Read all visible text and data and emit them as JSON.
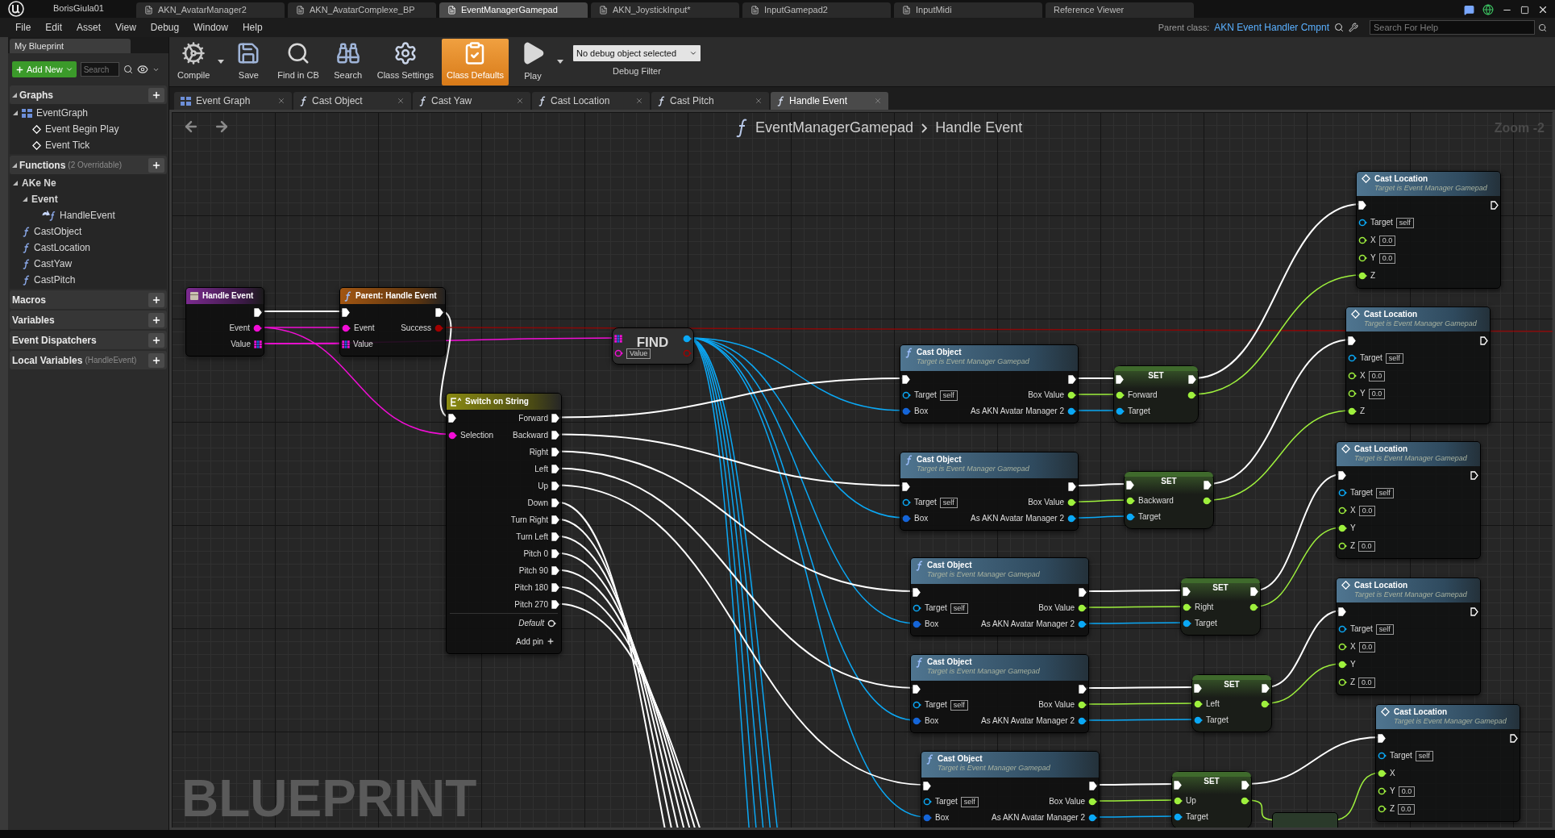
{
  "title_bar": {
    "project": "BorisGiula01",
    "tabs": [
      {
        "label": "AKN_AvatarManager2",
        "kind": "asset",
        "selected": false
      },
      {
        "label": "AKN_AvatarComplexe_BP",
        "kind": "asset",
        "selected": false
      },
      {
        "label": "EventManagerGamepad",
        "kind": "asset",
        "selected": true
      },
      {
        "label": "AKN_JoystickInput*",
        "kind": "asset",
        "selected": false
      },
      {
        "label": "InputGamepad2",
        "kind": "asset",
        "selected": false
      },
      {
        "label": "InputMidi",
        "kind": "asset",
        "selected": false
      },
      {
        "label": "Reference Viewer",
        "kind": "tool",
        "selected": false
      }
    ]
  },
  "menu": [
    "File",
    "Edit",
    "Asset",
    "View",
    "Debug",
    "Window",
    "Help"
  ],
  "parent_class": {
    "label": "Parent class:",
    "value": "AKN Event Handler Cmpnt"
  },
  "help_search": {
    "placeholder": "Search For Help"
  },
  "my_blueprint": {
    "tab": "My Blueprint",
    "add_new": "Add New",
    "search": {
      "placeholder": "Search"
    },
    "sections": [
      {
        "title": "Graphs",
        "expanded": true,
        "items": [
          {
            "label": "EventGraph",
            "kind": "graph",
            "expanded": true,
            "children": [
              {
                "label": "Event Begin Play",
                "kind": "event"
              },
              {
                "label": "Event Tick",
                "kind": "event"
              }
            ]
          }
        ]
      },
      {
        "title": "Functions",
        "note": "(2 Overridable)",
        "expanded": true,
        "items": [
          {
            "label": "AKe Ne",
            "kind": "category",
            "expanded": true,
            "children": [
              {
                "label": "Event",
                "kind": "category",
                "expanded": true,
                "children": [
                  {
                    "label": "HandleEvent",
                    "kind": "override"
                  }
                ]
              }
            ]
          },
          {
            "label": "CastObject",
            "kind": "function"
          },
          {
            "label": "CastLocation",
            "kind": "function"
          },
          {
            "label": "CastYaw",
            "kind": "function"
          },
          {
            "label": "CastPitch",
            "kind": "function"
          }
        ]
      },
      {
        "title": "Macros"
      },
      {
        "title": "Variables"
      },
      {
        "title": "Event Dispatchers"
      },
      {
        "title": "Local Variables",
        "note": "(HandleEvent)"
      }
    ]
  },
  "toolbar": {
    "buttons": [
      {
        "label": "Compile",
        "kind": "compile",
        "selected": false,
        "menu": true
      },
      {
        "label": "Save",
        "kind": "save",
        "selected": false,
        "menu": false
      },
      {
        "label": "Find in CB",
        "kind": "find",
        "selected": false,
        "menu": false
      },
      {
        "label": "Search",
        "kind": "search",
        "selected": false,
        "menu": false
      },
      {
        "label": "Class Settings",
        "kind": "settings",
        "selected": false,
        "menu": false
      },
      {
        "label": "Class Defaults",
        "kind": "defaults",
        "selected": true,
        "menu": false
      },
      {
        "label": "Play",
        "kind": "play",
        "selected": false,
        "menu": true
      }
    ],
    "debug": {
      "value": "No debug object selected",
      "label": "Debug Filter"
    }
  },
  "graph_tabs": [
    {
      "label": "Event Graph",
      "kind": "graph",
      "selected": false
    },
    {
      "label": "Cast Object",
      "kind": "function",
      "selected": false
    },
    {
      "label": "Cast Yaw",
      "kind": "function",
      "selected": false
    },
    {
      "label": "Cast Location",
      "kind": "function",
      "selected": false
    },
    {
      "label": "Cast Pitch",
      "kind": "function",
      "selected": false
    },
    {
      "label": "Handle Event",
      "kind": "function",
      "selected": true
    }
  ],
  "graph": {
    "breadcrumb": [
      "EventManagerGamepad",
      "Handle Event"
    ],
    "zoom": "Zoom -2",
    "watermark": "BLUEPRINT",
    "nodes": [
      {
        "kind": "event",
        "title": "Handle Event",
        "rows": [
          {
            "out": {
              "kind": "exec",
              "connected": true
            }
          },
          {
            "out": {
              "label": "Event",
              "kind": "string",
              "connected": true
            }
          },
          {
            "out": {
              "label": "Value",
              "kind": "array",
              "connected": true
            }
          }
        ]
      },
      {
        "kind": "parent",
        "title": "Parent: Handle Event",
        "rows": [
          {
            "in": {
              "kind": "exec",
              "connected": true
            },
            "out": {
              "kind": "exec",
              "connected": true
            }
          },
          {
            "in": {
              "label": "Event",
              "kind": "string",
              "connected": true
            },
            "out": {
              "label": "Success",
              "kind": "bool",
              "connected": true
            }
          },
          {
            "in": {
              "label": "Value",
              "kind": "array",
              "connected": true
            }
          }
        ]
      },
      {
        "kind": "find",
        "title": "FIND",
        "rows": [
          {
            "in": {
              "kind": "array",
              "connected": true
            },
            "out": {
              "kind": "object",
              "connected": true
            }
          },
          {
            "in": {
              "kind": "string",
              "connected": false,
              "default": "Value"
            },
            "out": {
              "kind": "bool",
              "connected": false
            }
          }
        ]
      },
      {
        "kind": "switch",
        "title": "Switch on String",
        "rows": [
          {
            "in": {
              "kind": "exec",
              "connected": true
            },
            "out": {
              "label": "Forward",
              "kind": "exec",
              "connected": true
            }
          },
          {
            "in": {
              "label": "Selection",
              "kind": "string",
              "connected": true
            },
            "out": {
              "label": "Backward",
              "kind": "exec",
              "connected": true
            }
          },
          {
            "out": {
              "label": "Right",
              "kind": "exec",
              "connected": true
            }
          },
          {
            "out": {
              "label": "Left",
              "kind": "exec",
              "connected": true
            }
          },
          {
            "out": {
              "label": "Up",
              "kind": "exec",
              "connected": true
            }
          },
          {
            "out": {
              "label": "Down",
              "kind": "exec",
              "connected": true
            }
          },
          {
            "out": {
              "label": "Turn Right",
              "kind": "exec",
              "connected": true
            }
          },
          {
            "out": {
              "label": "Turn Left",
              "kind": "exec",
              "connected": true
            }
          },
          {
            "out": {
              "label": "Pitch 0",
              "kind": "exec",
              "connected": true
            }
          },
          {
            "out": {
              "label": "Pitch 90",
              "kind": "exec",
              "connected": true
            }
          },
          {
            "out": {
              "label": "Pitch 180",
              "kind": "exec",
              "connected": true
            }
          },
          {
            "out": {
              "label": "Pitch 270",
              "kind": "exec",
              "connected": true
            }
          }
        ],
        "default_pin": {
          "label": "Default",
          "kind": "wildcard",
          "connected": false
        },
        "add_pin": "Add pin"
      },
      {
        "kind": "function",
        "title": "Cast Object",
        "subtitle": "Target is Event Manager Gamepad",
        "rows": [
          {
            "in": {
              "kind": "exec",
              "connected": true
            },
            "out": {
              "kind": "exec",
              "connected": true
            }
          },
          {
            "in": {
              "label": "Target",
              "kind": "object",
              "connected": false,
              "default": "self"
            },
            "out": {
              "label": "Box Value",
              "kind": "float",
              "connected": true
            }
          },
          {
            "in": {
              "label": "Box",
              "kind": "ref",
              "connected": true
            },
            "out": {
              "label": "As AKN Avatar Manager 2",
              "kind": "object",
              "connected": true
            }
          }
        ]
      },
      {
        "kind": "set",
        "title": "SET",
        "rows": [
          {
            "in": {
              "kind": "exec",
              "connected": true
            },
            "out": {
              "kind": "exec",
              "connected": true
            }
          },
          {
            "in": {
              "label": "Forward",
              "kind": "float",
              "connected": true
            },
            "out": {
              "kind": "float",
              "connected": true
            }
          },
          {
            "in": {
              "label": "Target",
              "kind": "object",
              "connected": true
            }
          }
        ]
      },
      {
        "kind": "function",
        "title": "Cast Object",
        "subtitle": "Target is Event Manager Gamepad",
        "rows": [
          {
            "in": {
              "kind": "exec",
              "connected": true
            },
            "out": {
              "kind": "exec",
              "connected": true
            }
          },
          {
            "in": {
              "label": "Target",
              "kind": "object",
              "connected": false,
              "default": "self"
            },
            "out": {
              "label": "Box Value",
              "kind": "float",
              "connected": true
            }
          },
          {
            "in": {
              "label": "Box",
              "kind": "ref",
              "connected": true
            },
            "out": {
              "label": "As AKN Avatar Manager 2",
              "kind": "object",
              "connected": true
            }
          }
        ]
      },
      {
        "kind": "set",
        "title": "SET",
        "rows": [
          {
            "in": {
              "kind": "exec",
              "connected": true
            },
            "out": {
              "kind": "exec",
              "connected": true
            }
          },
          {
            "in": {
              "label": "Backward",
              "kind": "float",
              "connected": true
            },
            "out": {
              "kind": "float",
              "connected": true
            }
          },
          {
            "in": {
              "label": "Target",
              "kind": "object",
              "connected": true
            }
          }
        ]
      },
      {
        "kind": "function",
        "title": "Cast Object",
        "subtitle": "Target is Event Manager Gamepad",
        "rows": [
          {
            "in": {
              "kind": "exec",
              "connected": true
            },
            "out": {
              "kind": "exec",
              "connected": true
            }
          },
          {
            "in": {
              "label": "Target",
              "kind": "object",
              "connected": false,
              "default": "self"
            },
            "out": {
              "label": "Box Value",
              "kind": "float",
              "connected": true
            }
          },
          {
            "in": {
              "label": "Box",
              "kind": "ref",
              "connected": true
            },
            "out": {
              "label": "As AKN Avatar Manager 2",
              "kind": "object",
              "connected": true
            }
          }
        ]
      },
      {
        "kind": "set",
        "title": "SET",
        "rows": [
          {
            "in": {
              "kind": "exec",
              "connected": true
            },
            "out": {
              "kind": "exec",
              "connected": true
            }
          },
          {
            "in": {
              "label": "Right",
              "kind": "float",
              "connected": true
            },
            "out": {
              "kind": "float",
              "connected": true
            }
          },
          {
            "in": {
              "label": "Target",
              "kind": "object",
              "connected": true
            }
          }
        ]
      },
      {
        "kind": "function",
        "title": "Cast Object",
        "subtitle": "Target is Event Manager Gamepad",
        "rows": [
          {
            "in": {
              "kind": "exec",
              "connected": true
            },
            "out": {
              "kind": "exec",
              "connected": true
            }
          },
          {
            "in": {
              "label": "Target",
              "kind": "object",
              "connected": false,
              "default": "self"
            },
            "out": {
              "label": "Box Value",
              "kind": "float",
              "connected": true
            }
          },
          {
            "in": {
              "label": "Box",
              "kind": "ref",
              "connected": true
            },
            "out": {
              "label": "As AKN Avatar Manager 2",
              "kind": "object",
              "connected": true
            }
          }
        ]
      },
      {
        "kind": "set",
        "title": "SET",
        "rows": [
          {
            "in": {
              "kind": "exec",
              "connected": true
            },
            "out": {
              "kind": "exec",
              "connected": true
            }
          },
          {
            "in": {
              "label": "Left",
              "kind": "float",
              "connected": true
            },
            "out": {
              "kind": "float",
              "connected": true
            }
          },
          {
            "in": {
              "label": "Target",
              "kind": "object",
              "connected": true
            }
          }
        ]
      },
      {
        "kind": "function",
        "title": "Cast Object",
        "subtitle": "Target is Event Manager Gamepad",
        "rows": [
          {
            "in": {
              "kind": "exec",
              "connected": true
            },
            "out": {
              "kind": "exec",
              "connected": true
            }
          },
          {
            "in": {
              "label": "Target",
              "kind": "object",
              "connected": false,
              "default": "self"
            },
            "out": {
              "label": "Box Value",
              "kind": "float",
              "connected": true
            }
          },
          {
            "in": {
              "label": "Box",
              "kind": "ref",
              "connected": true
            },
            "out": {
              "label": "As AKN Avatar Manager 2",
              "kind": "object",
              "connected": true
            }
          }
        ]
      },
      {
        "kind": "set",
        "title": "SET",
        "rows": [
          {
            "in": {
              "kind": "exec",
              "connected": true
            },
            "out": {
              "kind": "exec",
              "connected": true
            }
          },
          {
            "in": {
              "label": "Up",
              "kind": "float",
              "connected": true
            },
            "out": {
              "kind": "float",
              "connected": true
            }
          },
          {
            "in": {
              "label": "Target",
              "kind": "object",
              "connected": true
            }
          }
        ]
      },
      {
        "kind": "custom",
        "title": "Cast Location",
        "subtitle": "Target is Event Manager Gamepad",
        "rows": [
          {
            "in": {
              "kind": "exec",
              "connected": true
            },
            "out": {
              "kind": "exec",
              "connected": false
            }
          },
          {
            "in": {
              "label": "Target",
              "kind": "object",
              "connected": false,
              "default": "self"
            }
          },
          {
            "in": {
              "label": "X",
              "kind": "float",
              "connected": false,
              "default": "0.0"
            }
          },
          {
            "in": {
              "label": "Y",
              "kind": "float",
              "connected": false,
              "default": "0.0"
            }
          },
          {
            "in": {
              "label": "Z",
              "kind": "float",
              "connected": true
            }
          }
        ]
      },
      {
        "kind": "custom",
        "title": "Cast Location",
        "subtitle": "Target is Event Manager Gamepad",
        "rows": [
          {
            "in": {
              "kind": "exec",
              "connected": true
            },
            "out": {
              "kind": "exec",
              "connected": false
            }
          },
          {
            "in": {
              "label": "Target",
              "kind": "object",
              "connected": false,
              "default": "self"
            }
          },
          {
            "in": {
              "label": "X",
              "kind": "float",
              "connected": false,
              "default": "0.0"
            }
          },
          {
            "in": {
              "label": "Y",
              "kind": "float",
              "connected": false,
              "default": "0.0"
            }
          },
          {
            "in": {
              "label": "Z",
              "kind": "float",
              "connected": true
            }
          }
        ]
      },
      {
        "kind": "custom",
        "title": "Cast Location",
        "subtitle": "Target is Event Manager Gamepad",
        "rows": [
          {
            "in": {
              "kind": "exec",
              "connected": true
            },
            "out": {
              "kind": "exec",
              "connected": false
            }
          },
          {
            "in": {
              "label": "Target",
              "kind": "object",
              "connected": false,
              "default": "self"
            }
          },
          {
            "in": {
              "label": "X",
              "kind": "float",
              "connected": false,
              "default": "0.0"
            }
          },
          {
            "in": {
              "label": "Y",
              "kind": "float",
              "connected": true
            }
          },
          {
            "in": {
              "label": "Z",
              "kind": "float",
              "connected": false,
              "default": "0.0"
            }
          }
        ]
      },
      {
        "kind": "custom",
        "title": "Cast Location",
        "subtitle": "Target is Event Manager Gamepad",
        "rows": [
          {
            "in": {
              "kind": "exec",
              "connected": true
            },
            "out": {
              "kind": "exec",
              "connected": false
            }
          },
          {
            "in": {
              "label": "Target",
              "kind": "object",
              "connected": false,
              "default": "self"
            }
          },
          {
            "in": {
              "label": "X",
              "kind": "float",
              "connected": false,
              "default": "0.0"
            }
          },
          {
            "in": {
              "label": "Y",
              "kind": "float",
              "connected": true
            }
          },
          {
            "in": {
              "label": "Z",
              "kind": "float",
              "connected": false,
              "default": "0.0"
            }
          }
        ]
      },
      {
        "kind": "custom",
        "title": "Cast Location",
        "subtitle": "Target is Event Manager Gamepad",
        "rows": [
          {
            "in": {
              "kind": "exec",
              "connected": true
            },
            "out": {
              "kind": "exec",
              "connected": false
            }
          },
          {
            "in": {
              "label": "Target",
              "kind": "object",
              "connected": false,
              "default": "self"
            }
          },
          {
            "in": {
              "label": "X",
              "kind": "float",
              "connected": true
            }
          },
          {
            "in": {
              "label": "Y",
              "kind": "float",
              "connected": false,
              "default": "0.0"
            }
          },
          {
            "in": {
              "label": "Z",
              "kind": "float",
              "connected": false,
              "default": "0.0"
            }
          }
        ]
      }
    ]
  }
}
